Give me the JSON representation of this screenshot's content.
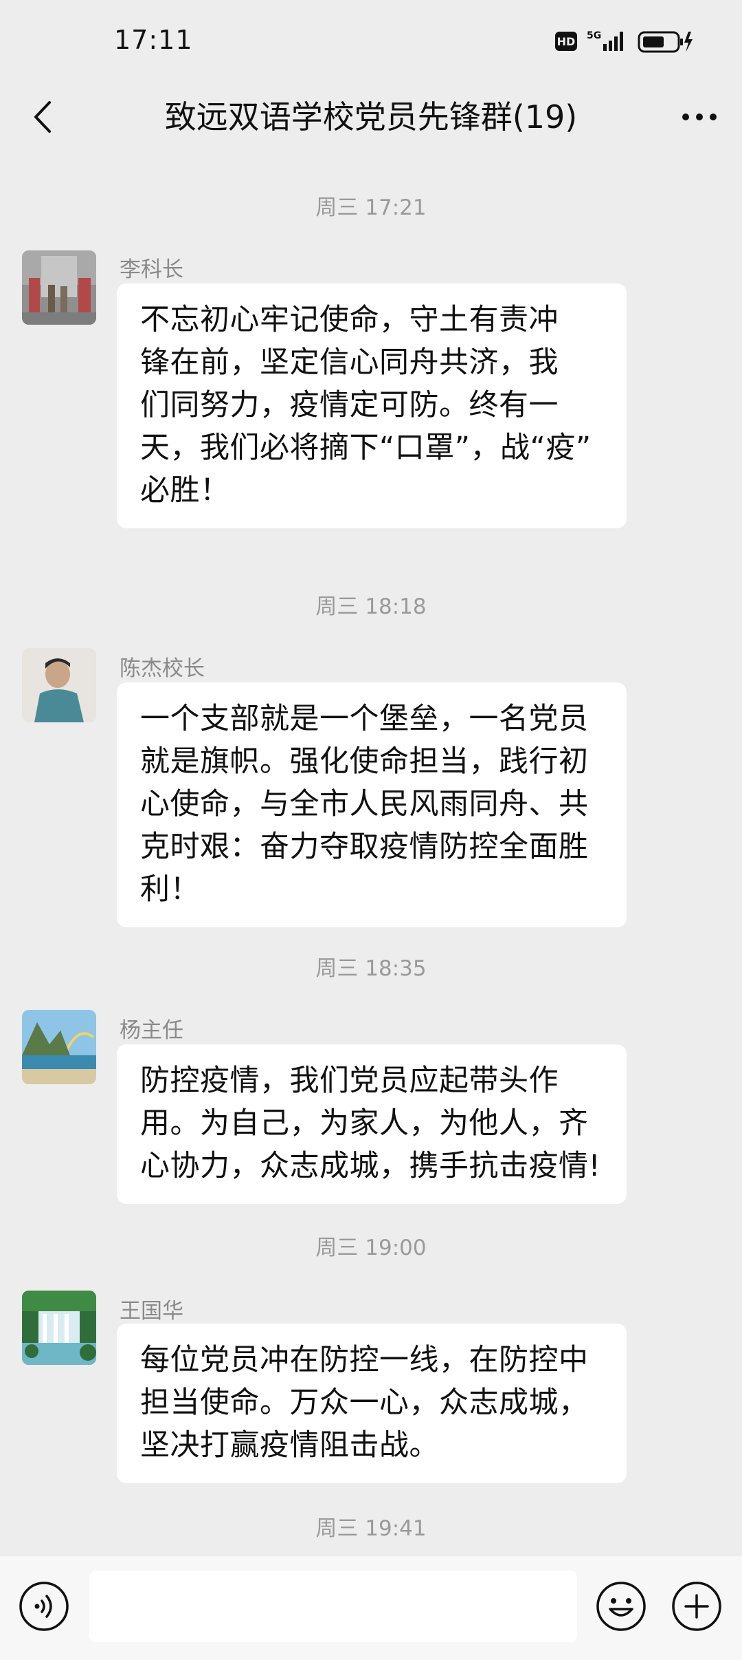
{
  "status_bar": {
    "time": "17:11",
    "hd": "HD",
    "network": "5G"
  },
  "header": {
    "title": "致远双语学校党员先锋群(19)"
  },
  "messages": [
    {
      "timestamp": "周三 17:21",
      "sender": "李科长",
      "avatar": "photo-group-avatar",
      "lines": [
        "不忘初心牢记使命，守土有责冲",
        "锋在前，坚定信心同舟共济，我",
        "们同努力，疫情定可防。终有一",
        "天，我们必将摘下“口罩”，战“疫”",
        "必胜！"
      ]
    },
    {
      "timestamp": "周三 18:18",
      "sender": "陈杰校长",
      "avatar": "person-avatar",
      "lines": [
        "一个支部就是一个堡垒，一名党员",
        "就是旗帜。强化使命担当，践行初",
        "心使命，与全市人民风雨同舟、共",
        "克时艰：奋力夺取疫情防控全面胜",
        "利！"
      ]
    },
    {
      "timestamp": "周三 18:35",
      "sender": "杨主任",
      "avatar": "landscape-rainbow-avatar",
      "lines": [
        "防控疫情，我们党员应起带头作",
        "用。为自己，为家人，为他人，齐",
        "心协力，众志成城，携手抗击疫情!"
      ]
    },
    {
      "timestamp": "周三 19:00",
      "sender": "王国华",
      "avatar": "waterfall-avatar",
      "lines": [
        "每位党员冲在防控一线，在防控中",
        "担当使命。万众一心，众志成城，",
        "坚决打赢疫情阻击战。"
      ]
    }
  ],
  "trailing_timestamp": "周三 19:41",
  "input_bar": {
    "placeholder": "",
    "voice_icon": "voice-icon",
    "emoji_icon": "emoji-icon",
    "plus_icon": "plus-icon"
  }
}
